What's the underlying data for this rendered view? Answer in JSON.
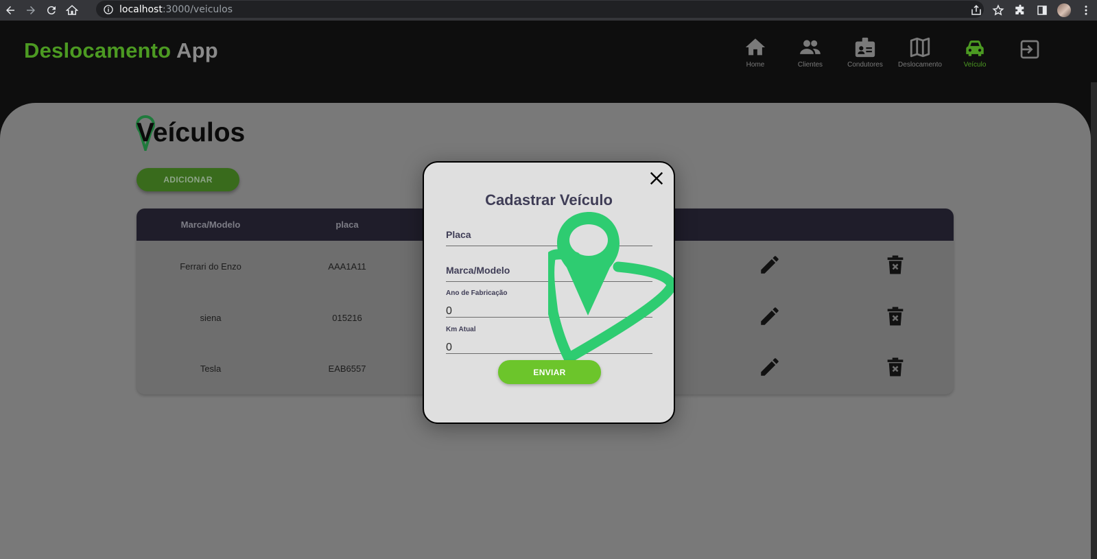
{
  "browser": {
    "url_host": "localhost",
    "url_path": ":3000/veiculos"
  },
  "header": {
    "brand_part1": "Deslocamento",
    "brand_part2": "App",
    "nav": [
      {
        "label": "Home",
        "icon": "home-icon"
      },
      {
        "label": "Clientes",
        "icon": "people-icon"
      },
      {
        "label": "Condutores",
        "icon": "badge-icon"
      },
      {
        "label": "Deslocamento",
        "icon": "map-icon"
      },
      {
        "label": "Veículo",
        "icon": "car-icon",
        "active": true
      }
    ],
    "logout_icon": "logout-icon"
  },
  "colors": {
    "brand_green": "#4c9a22",
    "accent_green": "#6cc52b",
    "header_bg": "#0e0e0e",
    "table_header_bg": "#1f1d2a",
    "modal_bg": "#dfdfdf",
    "pin_green": "#2ecc71"
  },
  "page": {
    "title": "Veículos",
    "add_button": "ADICIONAR"
  },
  "table": {
    "columns": [
      "Marca/Modelo",
      "placa"
    ],
    "rows": [
      {
        "marca_modelo": "Ferrari do Enzo",
        "placa": "AAA1A11"
      },
      {
        "marca_modelo": "siena",
        "placa": "015216"
      },
      {
        "marca_modelo": "Tesla",
        "placa": "EAB6557"
      }
    ]
  },
  "modal": {
    "title": "Cadastrar Veículo",
    "fields": {
      "placa_label": "Placa",
      "marca_label": "Marca/Modelo",
      "ano_label": "Ano de Fabricação",
      "ano_value": "0",
      "km_label": "Km Atual",
      "km_value": "0"
    },
    "submit": "ENVIAR"
  }
}
